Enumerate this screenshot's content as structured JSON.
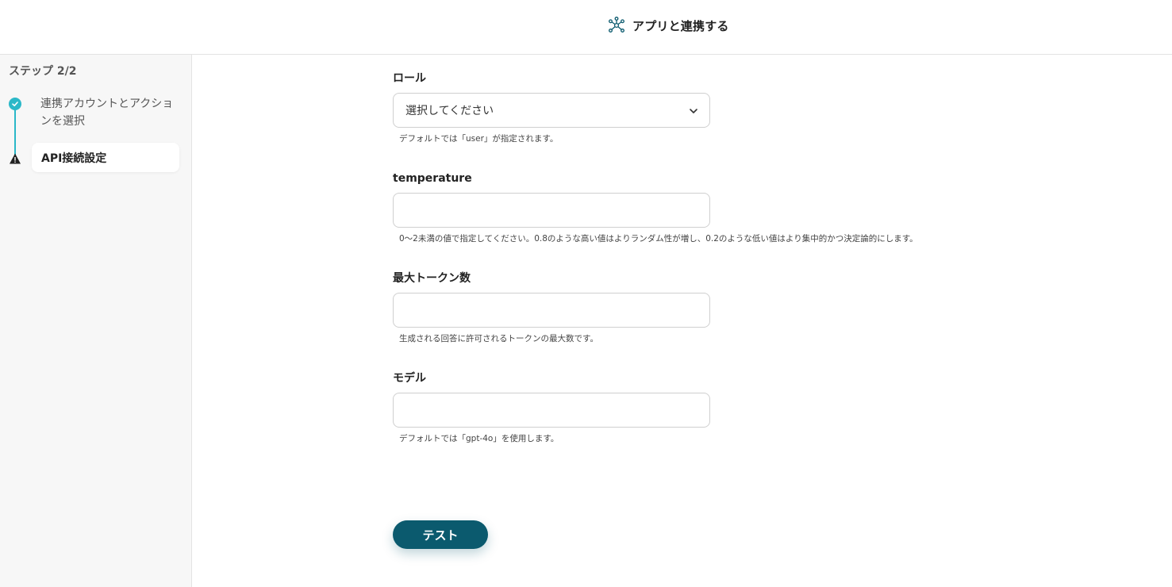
{
  "header": {
    "title": "アプリと連携する",
    "icon": "network-icon"
  },
  "sidebar": {
    "step_count": "ステップ 2/2",
    "steps": [
      {
        "label": "連携アカウントとアクションを選択",
        "status": "completed"
      },
      {
        "label": "API接続設定",
        "status": "warning",
        "active": true
      }
    ]
  },
  "form": {
    "role": {
      "label": "ロール",
      "placeholder": "選択してください",
      "hint": "デフォルトでは「user」が指定されます。"
    },
    "temperature": {
      "label": "temperature",
      "value": "",
      "hint": "0〜2未満の値で指定してください。0.8のような高い値はよりランダム性が増し、0.2のような低い値はより集中的かつ決定論的にします。"
    },
    "max_tokens": {
      "label": "最大トークン数",
      "value": "",
      "hint": "生成される回答に許可されるトークンの最大数です。"
    },
    "model": {
      "label": "モデル",
      "value": "",
      "hint": "デフォルトでは「gpt-4o」を使用します。"
    }
  },
  "actions": {
    "test_label": "テスト"
  },
  "colors": {
    "accent": "#2bb8c8",
    "primary": "#0b5a6e"
  }
}
